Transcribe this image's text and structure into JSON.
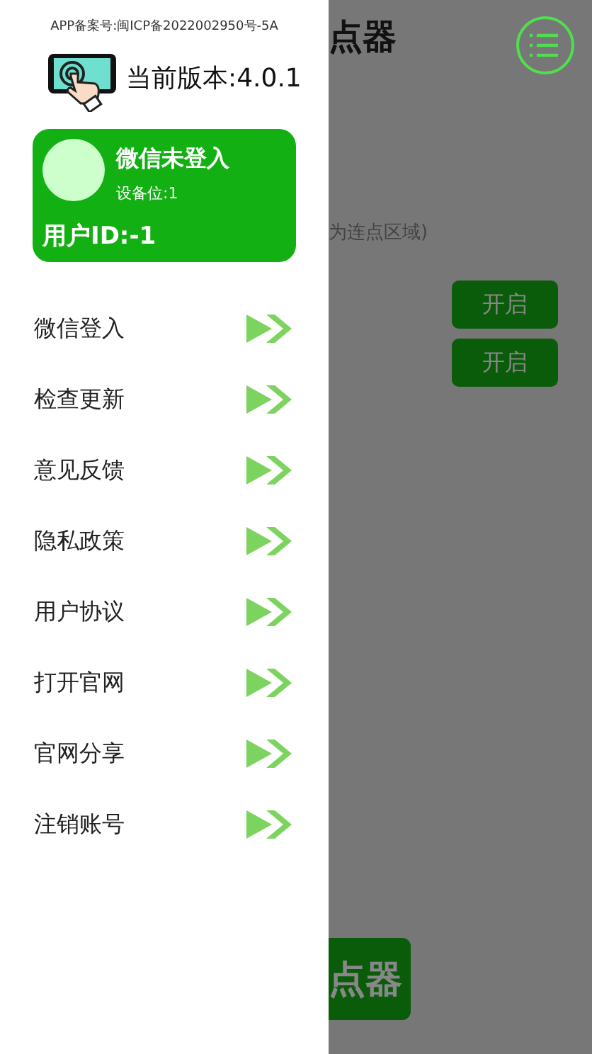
{
  "drawer": {
    "record_number": "APP备案号:闽ICP备2022002950号-5A",
    "version": "当前版本:4.0.1",
    "user_card": {
      "name": "微信未登入",
      "device": "设备位:1",
      "user_id": "用户ID:-1"
    },
    "menu_items": [
      {
        "label": "微信登入"
      },
      {
        "label": "检查更新"
      },
      {
        "label": "意见反馈"
      },
      {
        "label": "隐私政策"
      },
      {
        "label": "用户协议"
      },
      {
        "label": "打开官网"
      },
      {
        "label": "官网分享"
      },
      {
        "label": "注销账号"
      }
    ]
  },
  "background": {
    "title": "点器",
    "hint": "为连点区域)",
    "buttons": [
      "开启",
      "开启"
    ],
    "bottom_button": "点器"
  }
}
